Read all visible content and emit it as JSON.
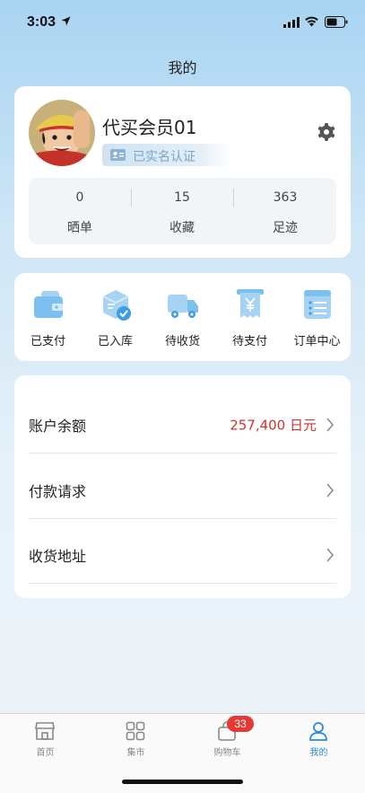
{
  "status": {
    "time": "3:03"
  },
  "header": {
    "title": "我的"
  },
  "profile": {
    "nickname": "代买会员01",
    "verified_label": "已实名认证",
    "stats": [
      {
        "value": "0",
        "label": "晒单"
      },
      {
        "value": "15",
        "label": "收藏"
      },
      {
        "value": "363",
        "label": "足迹"
      }
    ]
  },
  "orders": [
    {
      "label": "已支付",
      "icon": "wallet-icon"
    },
    {
      "label": "已入库",
      "icon": "package-check-icon"
    },
    {
      "label": "待收货",
      "icon": "truck-icon"
    },
    {
      "label": "待支付",
      "icon": "yen-receipt-icon"
    },
    {
      "label": "订单中心",
      "icon": "order-list-icon"
    }
  ],
  "menu": [
    {
      "label": "账户余额",
      "value": "257,400 日元"
    },
    {
      "label": "付款请求"
    },
    {
      "label": "收货地址"
    }
  ],
  "tabbar": {
    "items": [
      {
        "label": "首页",
        "icon": "home-store-icon"
      },
      {
        "label": "集市",
        "icon": "grid-icon"
      },
      {
        "label": "购物车",
        "icon": "shopping-bag-icon",
        "badge": "33"
      },
      {
        "label": "我的",
        "icon": "user-icon"
      }
    ],
    "active": "我的"
  },
  "colors": {
    "accent": "#2d8ad8",
    "price": "#d0342c",
    "badge": "#e53a33"
  }
}
